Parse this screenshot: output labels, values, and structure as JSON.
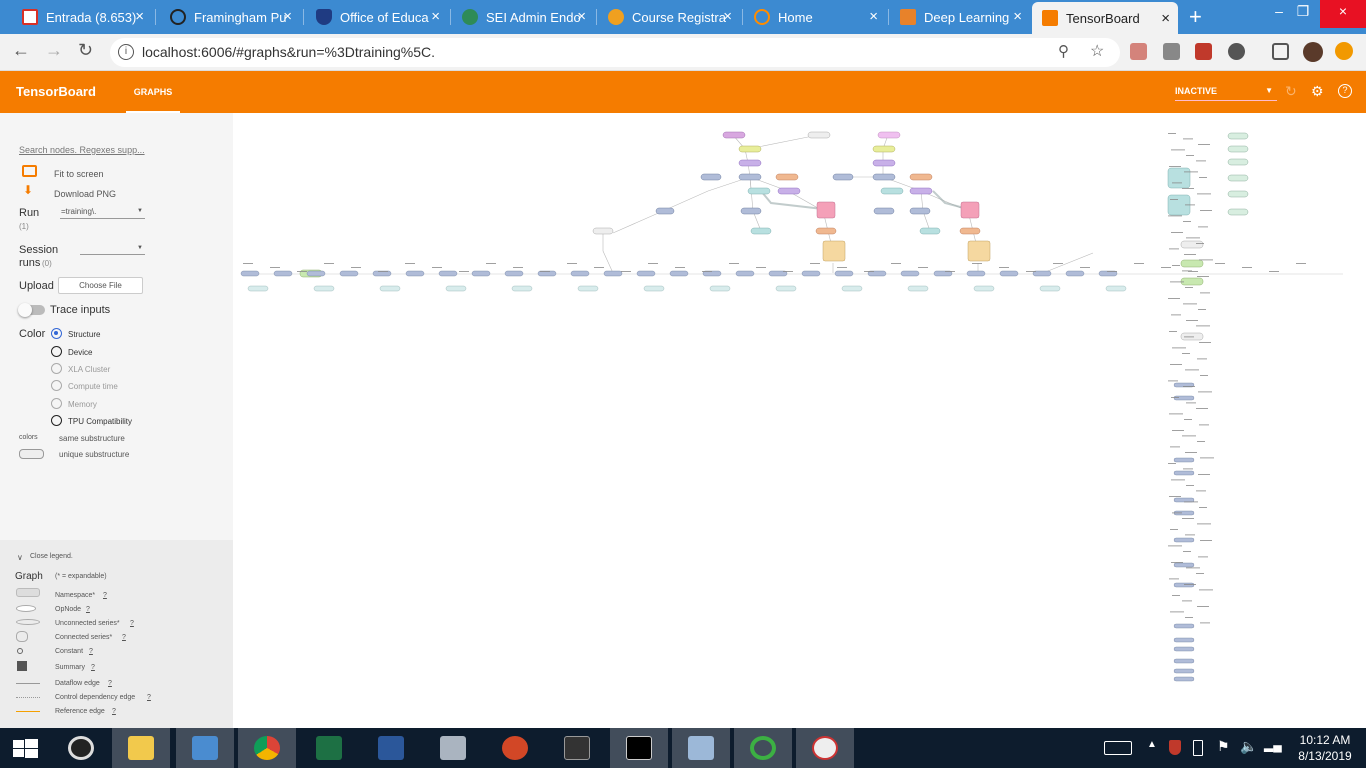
{
  "browser": {
    "tabs": [
      {
        "title": "Entrada (8.653)",
        "color": "#d93025",
        "active": false
      },
      {
        "title": "Framingham Pu",
        "color": "#333333",
        "active": false
      },
      {
        "title": "Office of Educa",
        "color": "#1f3b82",
        "active": false
      },
      {
        "title": "SEI Admin Endo",
        "color": "#2e8b57",
        "active": false
      },
      {
        "title": "Course Registra",
        "color": "#f0a020",
        "active": false
      },
      {
        "title": "Home",
        "color": "#ff8c00",
        "active": false
      },
      {
        "title": "Deep Learning",
        "color": "#e8822a",
        "active": false
      },
      {
        "title": "TensorBoard",
        "color": "#f57c00",
        "active": true
      }
    ],
    "new_tab": "+",
    "url": "localhost:6006/#graphs&run=%3Dtraining%5C."
  },
  "tensorboard": {
    "logo": "TensorBoard",
    "nav_tab": "GRAPHS",
    "status_select": "INACTIVE"
  },
  "sidebar": {
    "search_placeholder": "Search nodes. Regexes supp...",
    "fit_to_screen": "Fit to screen",
    "download_png": "Download PNG",
    "run_label": "Run",
    "run_count": "(1)",
    "run_value": "=training\\.",
    "session_label": "Session",
    "runs_label": "runs",
    "runs_count": "(0)",
    "upload_label": "Upload",
    "choose_file": "Choose File",
    "trace_inputs": "Trace inputs",
    "color_label": "Color",
    "color_options": [
      {
        "label": "Structure",
        "selected": true,
        "enabled": true
      },
      {
        "label": "Device",
        "selected": false,
        "enabled": true
      },
      {
        "label": "XLA Cluster",
        "selected": false,
        "enabled": false
      },
      {
        "label": "Compute time",
        "selected": false,
        "enabled": false
      },
      {
        "label": "Memory",
        "selected": false,
        "enabled": false
      },
      {
        "label": "TPU Compatibility",
        "selected": false,
        "enabled": true
      }
    ],
    "colors_label": "colors",
    "same_substructure": "same substructure",
    "unique_substructure": "unique substructure"
  },
  "legend": {
    "close_legend": "Close legend.",
    "graph_label": "Graph",
    "expandable_note": "(* = expandable)",
    "items": [
      {
        "label": "Namespace*",
        "q": "?"
      },
      {
        "label": "OpNode",
        "q": "?"
      },
      {
        "label": "Unconnected series*",
        "q": "?"
      },
      {
        "label": "Connected series*",
        "q": "?"
      },
      {
        "label": "Constant",
        "q": "?"
      },
      {
        "label": "Summary",
        "q": "?"
      },
      {
        "label": "Dataflow edge",
        "q": "?"
      },
      {
        "label": "Control dependency edge",
        "q": "?"
      },
      {
        "label": "Reference edge",
        "q": "?"
      }
    ]
  },
  "taskbar": {
    "time": "10:12 AM",
    "date": "8/13/2019"
  }
}
